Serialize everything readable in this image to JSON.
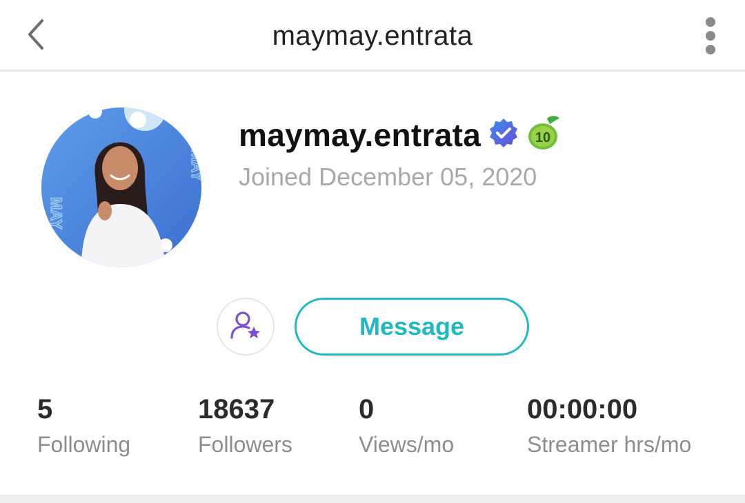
{
  "header": {
    "title": "maymay.entrata",
    "back_icon": "chevron-left-icon",
    "more_icon": "vertical-dots-icon"
  },
  "profile": {
    "username": "maymay.entrata",
    "verified_icon": "verified-badge-icon",
    "level_badge": "10",
    "joined_text": "Joined December 05, 2020",
    "avatar_text": "MAY"
  },
  "actions": {
    "fan_icon": "add-fan-star-icon",
    "message_label": "Message"
  },
  "stats": [
    {
      "value": "5",
      "label": "Following"
    },
    {
      "value": "18637",
      "label": "Followers"
    },
    {
      "value": "0",
      "label": "Views/mo"
    },
    {
      "value": "00:00:00",
      "label": "Streamer hrs/mo"
    }
  ],
  "colors": {
    "accent": "#1fb9c6",
    "purple": "#7b4fd6",
    "verified_blue": "#3d6fe6",
    "level_green": "#5aa632"
  }
}
